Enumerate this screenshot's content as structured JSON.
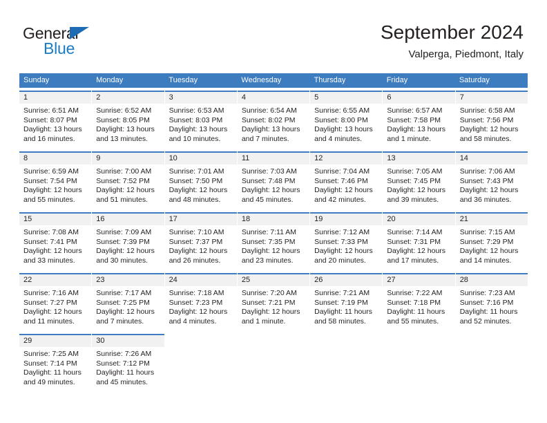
{
  "brand": {
    "line1": "General",
    "line2": "Blue",
    "triangle_icon": "triangle-logo-icon",
    "color_dark": "#231f20",
    "color_blue": "#1b7bc4"
  },
  "header": {
    "title": "September 2024",
    "subtitle": "Valperga, Piedmont, Italy"
  },
  "theme": {
    "header_blue": "#3c7cbf",
    "daynum_gray": "#f1f1f1",
    "text": "#231f20"
  },
  "weekdays": [
    "Sunday",
    "Monday",
    "Tuesday",
    "Wednesday",
    "Thursday",
    "Friday",
    "Saturday"
  ],
  "weeks": [
    [
      {
        "day": "1",
        "sunrise": "Sunrise: 6:51 AM",
        "sunset": "Sunset: 8:07 PM",
        "daylight1": "Daylight: 13 hours",
        "daylight2": "and 16 minutes."
      },
      {
        "day": "2",
        "sunrise": "Sunrise: 6:52 AM",
        "sunset": "Sunset: 8:05 PM",
        "daylight1": "Daylight: 13 hours",
        "daylight2": "and 13 minutes."
      },
      {
        "day": "3",
        "sunrise": "Sunrise: 6:53 AM",
        "sunset": "Sunset: 8:03 PM",
        "daylight1": "Daylight: 13 hours",
        "daylight2": "and 10 minutes."
      },
      {
        "day": "4",
        "sunrise": "Sunrise: 6:54 AM",
        "sunset": "Sunset: 8:02 PM",
        "daylight1": "Daylight: 13 hours",
        "daylight2": "and 7 minutes."
      },
      {
        "day": "5",
        "sunrise": "Sunrise: 6:55 AM",
        "sunset": "Sunset: 8:00 PM",
        "daylight1": "Daylight: 13 hours",
        "daylight2": "and 4 minutes."
      },
      {
        "day": "6",
        "sunrise": "Sunrise: 6:57 AM",
        "sunset": "Sunset: 7:58 PM",
        "daylight1": "Daylight: 13 hours",
        "daylight2": "and 1 minute."
      },
      {
        "day": "7",
        "sunrise": "Sunrise: 6:58 AM",
        "sunset": "Sunset: 7:56 PM",
        "daylight1": "Daylight: 12 hours",
        "daylight2": "and 58 minutes."
      }
    ],
    [
      {
        "day": "8",
        "sunrise": "Sunrise: 6:59 AM",
        "sunset": "Sunset: 7:54 PM",
        "daylight1": "Daylight: 12 hours",
        "daylight2": "and 55 minutes."
      },
      {
        "day": "9",
        "sunrise": "Sunrise: 7:00 AM",
        "sunset": "Sunset: 7:52 PM",
        "daylight1": "Daylight: 12 hours",
        "daylight2": "and 51 minutes."
      },
      {
        "day": "10",
        "sunrise": "Sunrise: 7:01 AM",
        "sunset": "Sunset: 7:50 PM",
        "daylight1": "Daylight: 12 hours",
        "daylight2": "and 48 minutes."
      },
      {
        "day": "11",
        "sunrise": "Sunrise: 7:03 AM",
        "sunset": "Sunset: 7:48 PM",
        "daylight1": "Daylight: 12 hours",
        "daylight2": "and 45 minutes."
      },
      {
        "day": "12",
        "sunrise": "Sunrise: 7:04 AM",
        "sunset": "Sunset: 7:46 PM",
        "daylight1": "Daylight: 12 hours",
        "daylight2": "and 42 minutes."
      },
      {
        "day": "13",
        "sunrise": "Sunrise: 7:05 AM",
        "sunset": "Sunset: 7:45 PM",
        "daylight1": "Daylight: 12 hours",
        "daylight2": "and 39 minutes."
      },
      {
        "day": "14",
        "sunrise": "Sunrise: 7:06 AM",
        "sunset": "Sunset: 7:43 PM",
        "daylight1": "Daylight: 12 hours",
        "daylight2": "and 36 minutes."
      }
    ],
    [
      {
        "day": "15",
        "sunrise": "Sunrise: 7:08 AM",
        "sunset": "Sunset: 7:41 PM",
        "daylight1": "Daylight: 12 hours",
        "daylight2": "and 33 minutes."
      },
      {
        "day": "16",
        "sunrise": "Sunrise: 7:09 AM",
        "sunset": "Sunset: 7:39 PM",
        "daylight1": "Daylight: 12 hours",
        "daylight2": "and 30 minutes."
      },
      {
        "day": "17",
        "sunrise": "Sunrise: 7:10 AM",
        "sunset": "Sunset: 7:37 PM",
        "daylight1": "Daylight: 12 hours",
        "daylight2": "and 26 minutes."
      },
      {
        "day": "18",
        "sunrise": "Sunrise: 7:11 AM",
        "sunset": "Sunset: 7:35 PM",
        "daylight1": "Daylight: 12 hours",
        "daylight2": "and 23 minutes."
      },
      {
        "day": "19",
        "sunrise": "Sunrise: 7:12 AM",
        "sunset": "Sunset: 7:33 PM",
        "daylight1": "Daylight: 12 hours",
        "daylight2": "and 20 minutes."
      },
      {
        "day": "20",
        "sunrise": "Sunrise: 7:14 AM",
        "sunset": "Sunset: 7:31 PM",
        "daylight1": "Daylight: 12 hours",
        "daylight2": "and 17 minutes."
      },
      {
        "day": "21",
        "sunrise": "Sunrise: 7:15 AM",
        "sunset": "Sunset: 7:29 PM",
        "daylight1": "Daylight: 12 hours",
        "daylight2": "and 14 minutes."
      }
    ],
    [
      {
        "day": "22",
        "sunrise": "Sunrise: 7:16 AM",
        "sunset": "Sunset: 7:27 PM",
        "daylight1": "Daylight: 12 hours",
        "daylight2": "and 11 minutes."
      },
      {
        "day": "23",
        "sunrise": "Sunrise: 7:17 AM",
        "sunset": "Sunset: 7:25 PM",
        "daylight1": "Daylight: 12 hours",
        "daylight2": "and 7 minutes."
      },
      {
        "day": "24",
        "sunrise": "Sunrise: 7:18 AM",
        "sunset": "Sunset: 7:23 PM",
        "daylight1": "Daylight: 12 hours",
        "daylight2": "and 4 minutes."
      },
      {
        "day": "25",
        "sunrise": "Sunrise: 7:20 AM",
        "sunset": "Sunset: 7:21 PM",
        "daylight1": "Daylight: 12 hours",
        "daylight2": "and 1 minute."
      },
      {
        "day": "26",
        "sunrise": "Sunrise: 7:21 AM",
        "sunset": "Sunset: 7:19 PM",
        "daylight1": "Daylight: 11 hours",
        "daylight2": "and 58 minutes."
      },
      {
        "day": "27",
        "sunrise": "Sunrise: 7:22 AM",
        "sunset": "Sunset: 7:18 PM",
        "daylight1": "Daylight: 11 hours",
        "daylight2": "and 55 minutes."
      },
      {
        "day": "28",
        "sunrise": "Sunrise: 7:23 AM",
        "sunset": "Sunset: 7:16 PM",
        "daylight1": "Daylight: 11 hours",
        "daylight2": "and 52 minutes."
      }
    ],
    [
      {
        "day": "29",
        "sunrise": "Sunrise: 7:25 AM",
        "sunset": "Sunset: 7:14 PM",
        "daylight1": "Daylight: 11 hours",
        "daylight2": "and 49 minutes."
      },
      {
        "day": "30",
        "sunrise": "Sunrise: 7:26 AM",
        "sunset": "Sunset: 7:12 PM",
        "daylight1": "Daylight: 11 hours",
        "daylight2": "and 45 minutes."
      },
      {
        "day": "",
        "sunrise": "",
        "sunset": "",
        "daylight1": "",
        "daylight2": ""
      },
      {
        "day": "",
        "sunrise": "",
        "sunset": "",
        "daylight1": "",
        "daylight2": ""
      },
      {
        "day": "",
        "sunrise": "",
        "sunset": "",
        "daylight1": "",
        "daylight2": ""
      },
      {
        "day": "",
        "sunrise": "",
        "sunset": "",
        "daylight1": "",
        "daylight2": ""
      },
      {
        "day": "",
        "sunrise": "",
        "sunset": "",
        "daylight1": "",
        "daylight2": ""
      }
    ]
  ]
}
